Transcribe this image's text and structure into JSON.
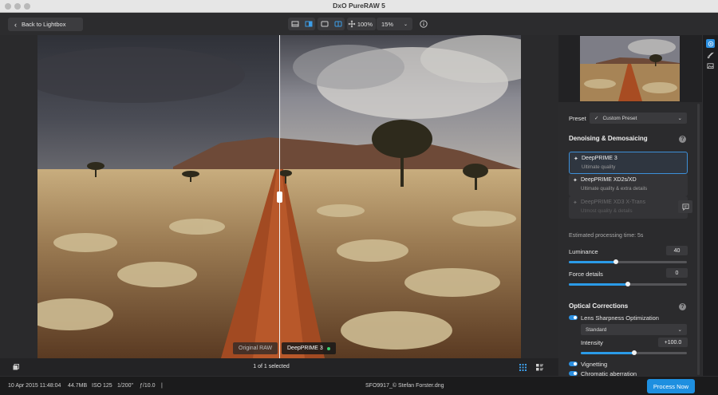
{
  "window": {
    "title": "DxO PureRAW 5"
  },
  "toolbar": {
    "back_label": "Back to Lightbox",
    "zoom_fit": "100%",
    "zoom_level": "15%"
  },
  "viewer": {
    "left_label": "Original RAW",
    "right_label": "DeepPRIME 3",
    "selection": "1 of 1 selected"
  },
  "panel": {
    "preset_label": "Preset",
    "preset_value": "Custom Preset",
    "denoise_header": "Denoising & Demosaicing",
    "engines": [
      {
        "title": "DeepPRIME 3",
        "subtitle": "Ultimate quality"
      },
      {
        "title": "DeepPRIME XD2s/XD",
        "subtitle": "Ultimate quality & extra details"
      },
      {
        "title": "DeepPRIME XD3 X-Trans",
        "subtitle": "Utmost quality & details"
      }
    ],
    "estimated_time": "Estimated processing time:  5s",
    "luminance_label": "Luminance",
    "luminance_value": "40",
    "luminance_level": 0.4,
    "force_label": "Force details",
    "force_value": "0",
    "force_level": 0.5,
    "optical_header": "Optical Corrections",
    "lens_label": "Lens Sharpness Optimization",
    "lens_mode": "Standard",
    "intensity_label": "Intensity",
    "intensity_value": "+100.0",
    "intensity_level": 0.5,
    "vignetting_label": "Vignetting",
    "chromatic_label": "Chromatic aberration"
  },
  "status": {
    "date": "10 Apr 2015 11:48:04",
    "size": "44.7MB",
    "iso": "ISO 125",
    "shutter": "1/200\"",
    "aperture": "ƒ/10.0",
    "separator": "|",
    "filename": "SFO9917_© Stefan Forster.dng",
    "process_label": "Process Now"
  },
  "colors": {
    "accent": "#1e8fe0",
    "selected_dot": "#3cd070"
  },
  "icons": [
    "chevron-left-icon",
    "single-view-icon",
    "split-view-icon",
    "side-by-side-icon",
    "compare-icon",
    "pan-icon",
    "info-icon",
    "filmstrip-icon",
    "grid-view-icon",
    "list-view-icon",
    "note-icon",
    "help-icon"
  ]
}
